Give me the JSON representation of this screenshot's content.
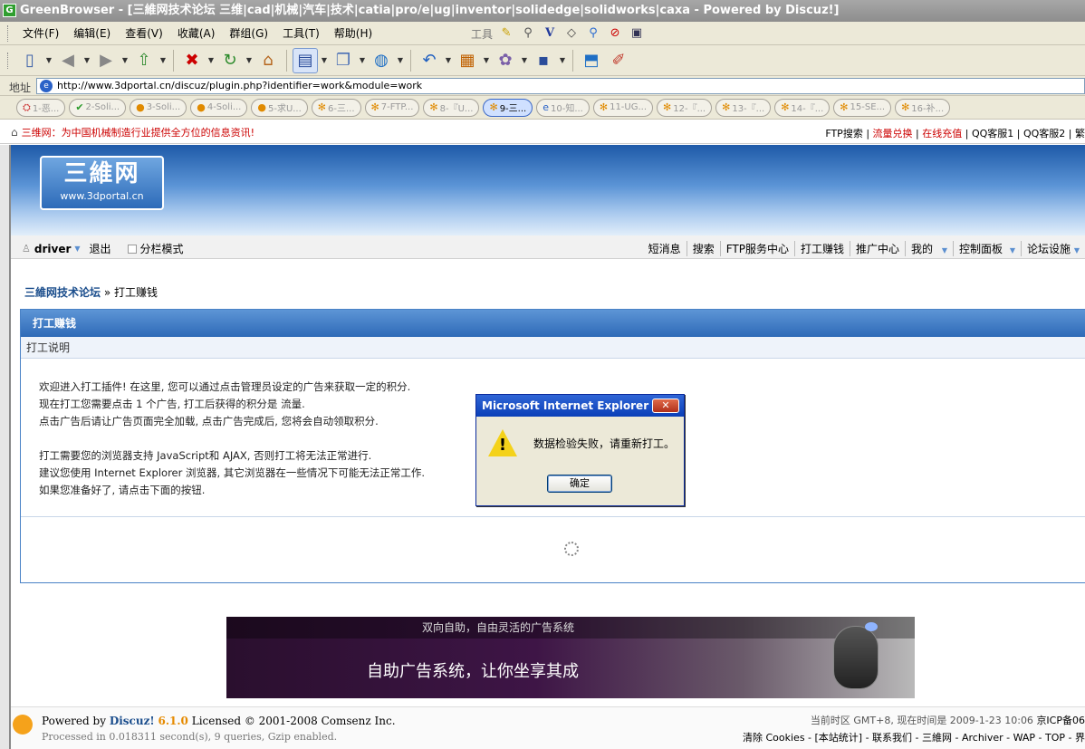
{
  "window": {
    "title": "GreenBrowser - [三維网技术论坛 三维|cad|机械|汽车|技术|catia|pro/e|ug|inventor|solidedge|solidworks|caxa - Powered by Discuz!]",
    "app_icon_letter": "G"
  },
  "menu": {
    "items": [
      "文件(F)",
      "编辑(E)",
      "查看(V)",
      "收藏(A)",
      "群组(G)",
      "工具(T)",
      "帮助(H)"
    ],
    "tools_label": "工具"
  },
  "address": {
    "label": "地址",
    "url": "http://www.3dportal.cn/discuz/plugin.php?identifier=work&module=work"
  },
  "tabs": [
    {
      "label": "1-恶..."
    },
    {
      "label": "2-Soli..."
    },
    {
      "label": "3-Soli..."
    },
    {
      "label": "4-Soli..."
    },
    {
      "label": "5-求U..."
    },
    {
      "label": "6-三..."
    },
    {
      "label": "7-FTP..."
    },
    {
      "label": "8-『U..."
    },
    {
      "label": "9-三...",
      "active": true
    },
    {
      "label": "10-知..."
    },
    {
      "label": "11-UG..."
    },
    {
      "label": "12-『..."
    },
    {
      "label": "13-『..."
    },
    {
      "label": "14-『..."
    },
    {
      "label": "15-SE..."
    },
    {
      "label": "16-补..."
    }
  ],
  "topinfo": {
    "slogan": "三维网：为中国机械制造行业提供全方位的信息资讯!",
    "links": [
      "FTP搜索",
      "流量兑换",
      "在线充值",
      "QQ客服1",
      "QQ客服2",
      "繁"
    ]
  },
  "logo": {
    "big": "三維网",
    "url": "www.3dportal.cn"
  },
  "userbar": {
    "username": "driver",
    "logout": "退出",
    "column_mode": "分栏模式",
    "nav": [
      "短消息",
      "搜索",
      "FTP服务中心",
      "打工赚钱",
      "推广中心",
      "我的",
      "控制面板",
      "论坛设施"
    ]
  },
  "breadcrumb": {
    "home": "三維网技术论坛",
    "sep": "»",
    "current": "打工赚钱"
  },
  "panel": {
    "title": "打工赚钱",
    "subtitle": "打工说明",
    "lines": [
      "欢迎进入打工插件! 在这里, 您可以通过点击管理员设定的广告来获取一定的积分.",
      "现在打工您需要点击  1 个广告, 打工后获得的积分是  流量.",
      "点击广告后请让广告页面完全加载, 点击广告完成后, 您将会自动领取积分.",
      "",
      "打工需要您的浏览器支持  JavaScript和  AJAX, 否则打工将无法正常进行.",
      "建议您使用  Internet Explorer 浏览器, 其它浏览器在一些情况下可能无法正常工作.",
      "如果您准备好了, 请点击下面的按钮."
    ]
  },
  "ad": {
    "top": "双向自助，自由灵活的广告系统",
    "main": "自助广告系统，让你坐享其成"
  },
  "footer": {
    "powered": "Powered by",
    "brand": "Discuz!",
    "version": "6.1.0",
    "license": "Licensed © 2001-2008 Comsenz Inc.",
    "processed": "Processed in 0.018311 second(s), 9 queries, Gzip enabled.",
    "time_label": "当前时区  GMT+8, 现在时间是  2009-1-23 10:06",
    "icp": "京ICP备06",
    "links": "清除  Cookies - [本站统计] - 联系我们 - 三維网 - Archiver - WAP - TOP - 界"
  },
  "dialog": {
    "title": "Microsoft Internet Explorer",
    "close": "✕",
    "message": "数据检验失败，请重新打工。",
    "ok": "确定"
  }
}
